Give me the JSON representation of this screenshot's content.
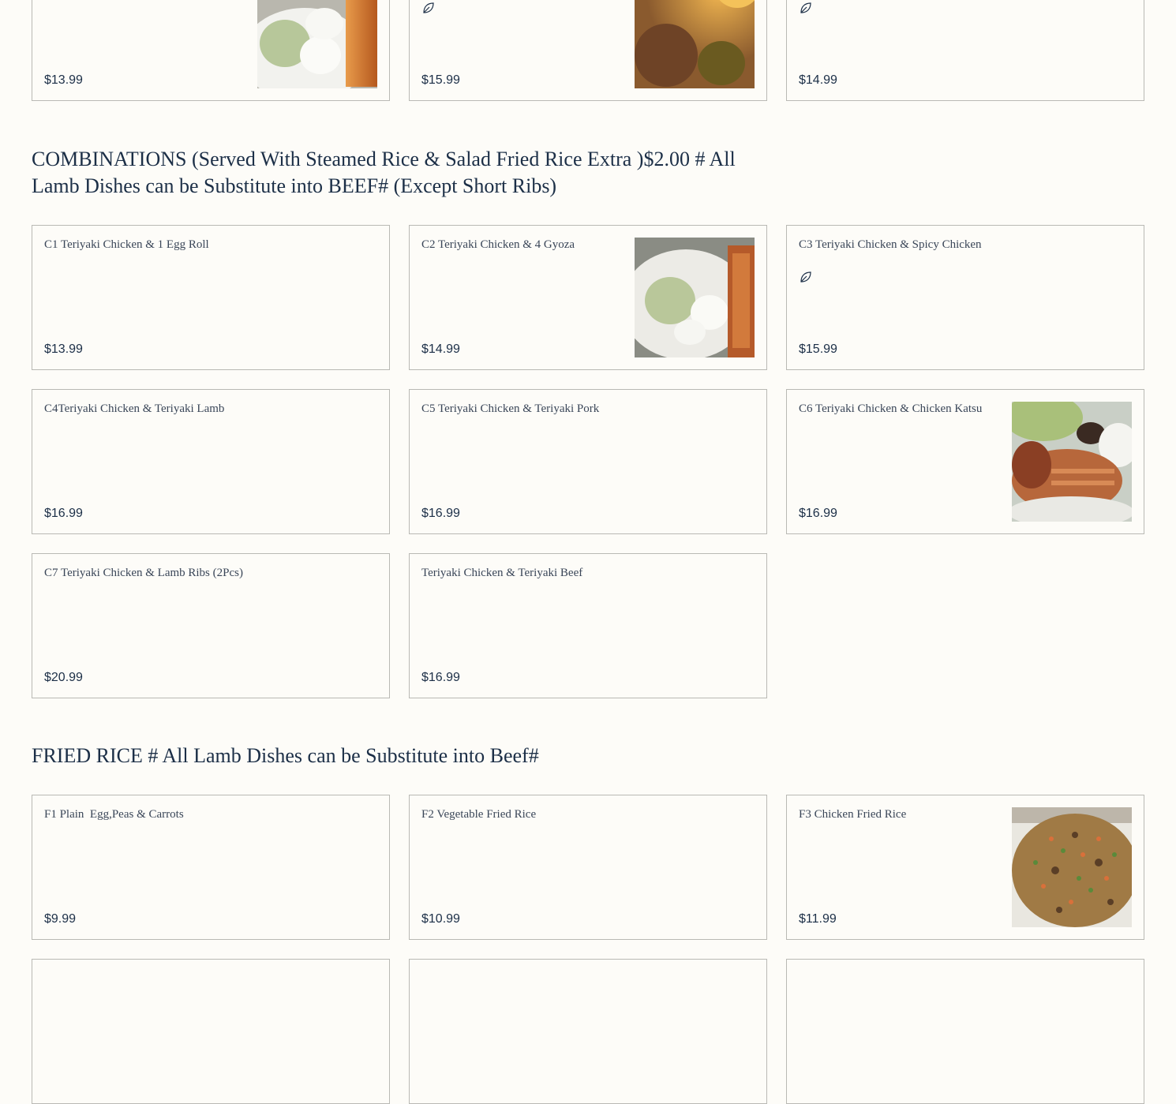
{
  "top_row": {
    "prices": [
      "$13.99",
      "$15.99",
      "$14.99"
    ]
  },
  "combinations": {
    "title": "COMBINATIONS (Served With Steamed Rice & Salad Fried Rice Extra )$2.00 # All Lamb Dishes can be Substitute into BEEF# (Except Short Ribs)",
    "items": [
      {
        "name": "C1 Teriyaki Chicken & 1 Egg Roll",
        "price": "$13.99"
      },
      {
        "name": "C2 Teriyaki Chicken & 4 Gyoza",
        "price": "$14.99"
      },
      {
        "name": "C3 Teriyaki Chicken & Spicy Chicken",
        "price": "$15.99"
      },
      {
        "name": "C4Teriyaki Chicken & Teriyaki Lamb",
        "price": "$16.99"
      },
      {
        "name": "C5 Teriyaki Chicken & Teriyaki Pork",
        "price": "$16.99"
      },
      {
        "name": "C6 Teriyaki Chicken & Chicken Katsu",
        "price": "$16.99"
      },
      {
        "name": "C7 Teriyaki Chicken & Lamb Ribs (2Pcs)",
        "price": "$20.99"
      },
      {
        "name": "Teriyaki Chicken & Teriyaki Beef",
        "price": "$16.99"
      }
    ]
  },
  "fried_rice": {
    "title": "FRIED RICE # All Lamb Dishes can be Substitute into Beef#",
    "items": [
      {
        "name": "F1 Plain  Egg,Peas & Carrots",
        "price": "$9.99"
      },
      {
        "name": "F2 Vegetable Fried Rice",
        "price": "$10.99"
      },
      {
        "name": "F3 Chicken Fried Rice",
        "price": "$11.99"
      }
    ]
  },
  "icons": {
    "spicy": "leaf-icon"
  },
  "colors": {
    "background": "#fdfcf8",
    "text": "#1c2f47",
    "border": "#b9b9b4"
  }
}
